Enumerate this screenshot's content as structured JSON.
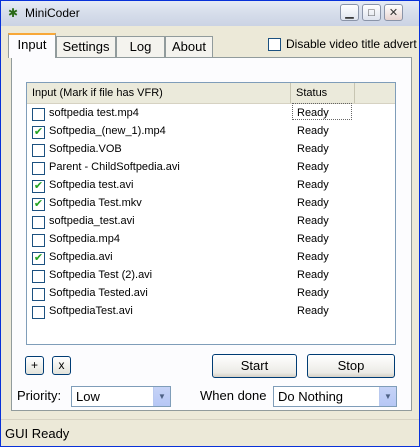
{
  "window": {
    "title": "MiniCoder",
    "icon": "minicoder-app-icon"
  },
  "titlebar_buttons": {
    "minimize": "minimize-icon",
    "maximize": "maximize-icon",
    "close": "close-icon"
  },
  "tabs": [
    {
      "label": "Input",
      "active": true
    },
    {
      "label": "Settings",
      "active": false
    },
    {
      "label": "Log",
      "active": false
    },
    {
      "label": "About",
      "active": false
    }
  ],
  "disable_advert": {
    "label": "Disable video title advert",
    "checked": false
  },
  "file_list": {
    "columns": [
      "Input (Mark if file has VFR)",
      "Status"
    ],
    "rows": [
      {
        "name": "softpedia test.mp4",
        "status": "Ready",
        "checked": false
      },
      {
        "name": "Softpedia_(new_1).mp4",
        "status": "Ready",
        "checked": true
      },
      {
        "name": "Softpedia.VOB",
        "status": "Ready",
        "checked": false
      },
      {
        "name": "Parent - ChildSoftpedia.avi",
        "status": "Ready",
        "checked": false
      },
      {
        "name": "Softpedia test.avi",
        "status": "Ready",
        "checked": true
      },
      {
        "name": "Softpedia Test.mkv",
        "status": "Ready",
        "checked": true
      },
      {
        "name": "softpedia_test.avi",
        "status": "Ready",
        "checked": false
      },
      {
        "name": "Softpedia.mp4",
        "status": "Ready",
        "checked": false
      },
      {
        "name": "Softpedia.avi",
        "status": "Ready",
        "checked": true
      },
      {
        "name": "Softpedia Test (2).avi",
        "status": "Ready",
        "checked": false
      },
      {
        "name": "Softpedia Tested.avi",
        "status": "Ready",
        "checked": false
      },
      {
        "name": "SoftpediaTest.avi",
        "status": "Ready",
        "checked": false
      }
    ]
  },
  "buttons": {
    "add": "+",
    "remove": "x",
    "start": "Start",
    "stop": "Stop"
  },
  "priority": {
    "label": "Priority:",
    "value": "Low"
  },
  "when_done": {
    "label": "When done",
    "value": "Do Nothing"
  },
  "status_bar": "GUI Ready"
}
